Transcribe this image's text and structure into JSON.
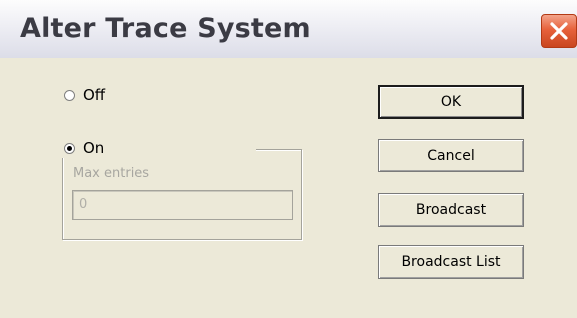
{
  "dialog": {
    "title": "Alter Trace System",
    "close_icon": "close-x-icon"
  },
  "options": {
    "off_label": "Off",
    "off_selected": false,
    "on_label": "On",
    "on_selected": true,
    "max_entries_label": "Max entries",
    "max_entries_value": "0",
    "max_entries_enabled": false
  },
  "buttons": {
    "ok_label": "OK",
    "cancel_label": "Cancel",
    "broadcast_label": "Broadcast",
    "broadcast_list_label": "Broadcast List"
  },
  "colors": {
    "dialog_bg": "#ece9d8",
    "close_button": "#e7623c",
    "disabled_text": "#a7a6a0"
  }
}
